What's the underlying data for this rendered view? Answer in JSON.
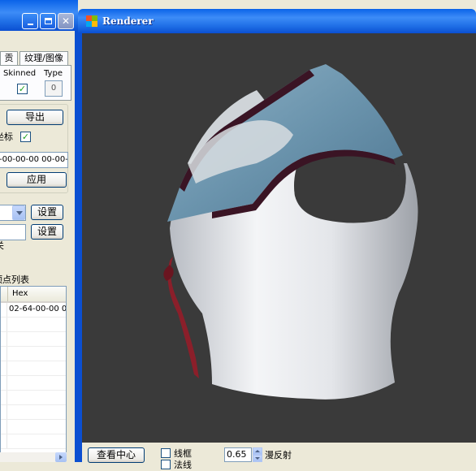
{
  "left_panel": {
    "tabs": [
      "贡",
      "纹理/图像"
    ],
    "skinned_label": "Skinned",
    "type_label": "Type",
    "type_value": "0",
    "export_button": "导出",
    "coord_label": "坐标",
    "hex_field_value": "-00-00-00 00-00-",
    "apply_button": "应用",
    "set_button_1": "设置",
    "set_button_2": "设置",
    "misc_label": "关",
    "vertex_list_label": "顶点列表",
    "grid": {
      "columns": [
        "",
        "Hex"
      ],
      "rows": [
        [
          "",
          "02-64-00-00 0"
        ]
      ]
    }
  },
  "renderer": {
    "title": "Renderer",
    "view_center_button": "查看中心",
    "wireframe_label": "线框",
    "normals_label": "法线",
    "diffuse_value": "0.65",
    "diffuse_label": "漫反射"
  },
  "colors": {
    "titlebar": "#0b4fd1",
    "viewport_bg": "#3a3a3a",
    "collar_blue": "#6b94ad",
    "collar_trim": "#3a1424",
    "ribbon_red": "#8b1f2a"
  }
}
